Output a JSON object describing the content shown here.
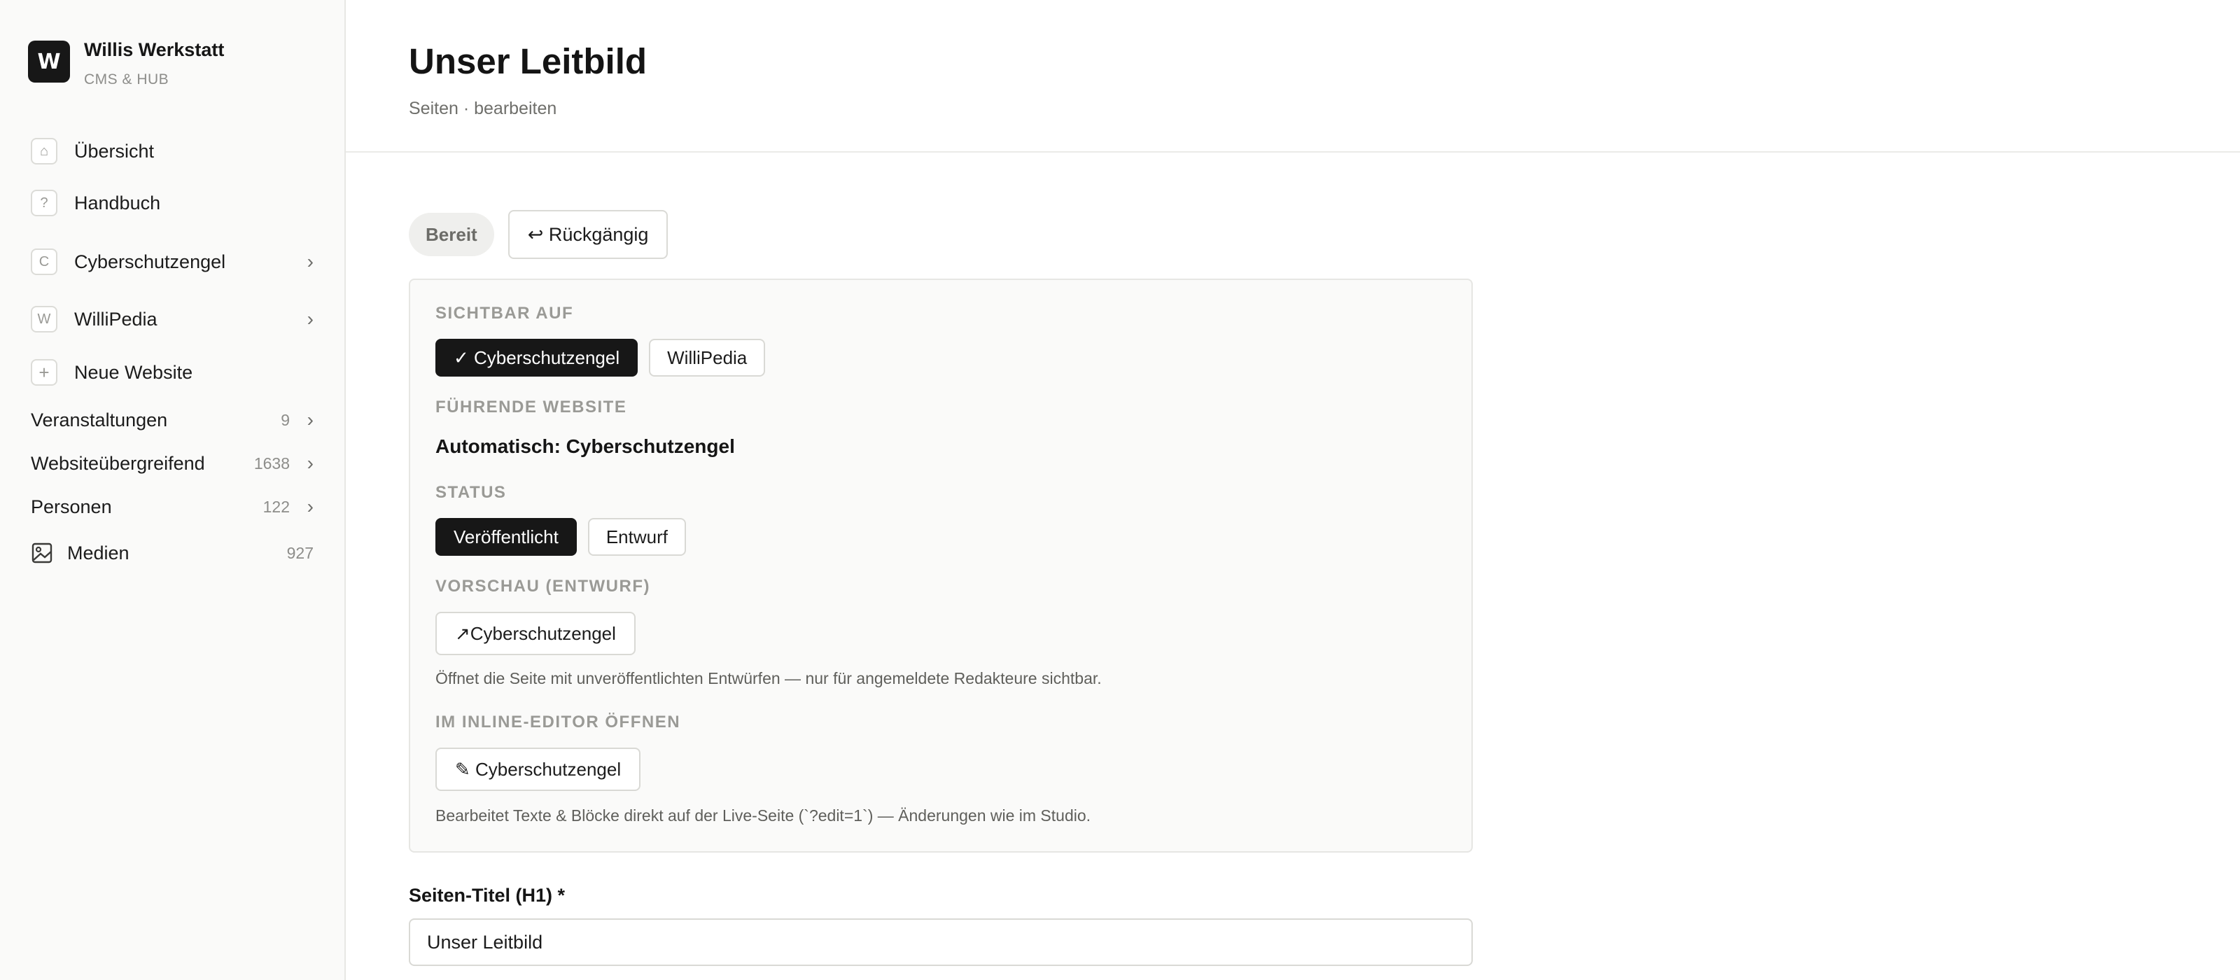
{
  "brand": {
    "logo_letter": "W",
    "name": "Willis Werkstatt",
    "subtitle": "CMS & HUB"
  },
  "sidebar": {
    "items": [
      {
        "icon": "⌂",
        "label": "Übersicht"
      },
      {
        "icon": "?",
        "label": "Handbuch"
      },
      {
        "icon": "C",
        "label": "Cyberschutzengel",
        "chevron": "›"
      },
      {
        "icon": "W",
        "label": "WilliPedia",
        "chevron": "›"
      },
      {
        "icon": "+",
        "label": "Neue Website"
      }
    ],
    "counted": [
      {
        "label": "Veranstaltungen",
        "count": "9",
        "chevron": "›"
      },
      {
        "label": "Websiteübergreifend",
        "count": "1638",
        "chevron": "›"
      },
      {
        "label": "Personen",
        "count": "122",
        "chevron": "›"
      }
    ],
    "media": {
      "label": "Medien",
      "count": "927"
    }
  },
  "header": {
    "title": "Unser Leitbild",
    "subtitle": "Seiten · bearbeiten"
  },
  "toolbar": {
    "status_pill": "Bereit",
    "undo_label": "↩ Rückgängig"
  },
  "panel": {
    "visible_on": {
      "label": "SICHTBAR AUF",
      "options": [
        {
          "label": "✓ Cyberschutzengel",
          "active": true
        },
        {
          "label": "WilliPedia",
          "active": false
        }
      ]
    },
    "leading": {
      "label": "FÜHRENDE WEBSITE",
      "value": "Automatisch: Cyberschutzengel"
    },
    "status": {
      "label": "STATUS",
      "options": [
        {
          "label": "Veröffentlicht",
          "active": true
        },
        {
          "label": "Entwurf",
          "active": false
        }
      ]
    },
    "preview": {
      "label": "VORSCHAU (ENTWURF)",
      "button": "↗Cyberschutzengel",
      "hint": "Öffnet die Seite mit unveröffentlichten Entwürfen — nur für angemeldete Redakteure sichtbar."
    },
    "inline_editor": {
      "label": "IM INLINE-EDITOR ÖFFNEN",
      "button": "✎ Cyberschutzengel",
      "hint": "Bearbeitet Texte & Blöcke direkt auf der Live-Seite (`?edit=1`) — Änderungen wie im Studio."
    }
  },
  "form": {
    "title_label": "Seiten-Titel (H1) *",
    "title_value": "Unser Leitbild"
  },
  "colors": {
    "accent": "#171717",
    "sidebar_bg": "#fafaf9",
    "panel_bg": "#fafaf9"
  }
}
